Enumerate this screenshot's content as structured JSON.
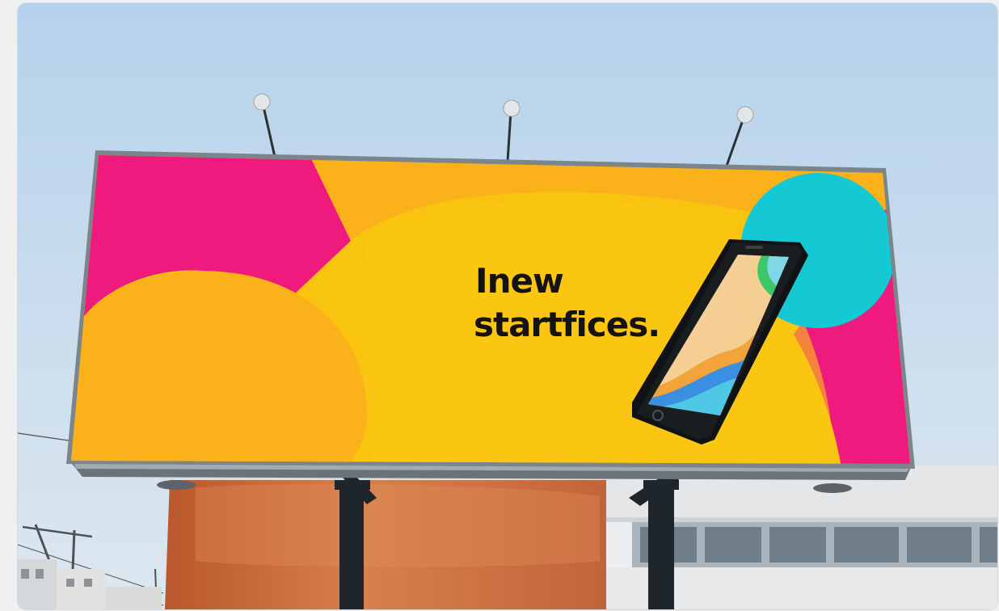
{
  "billboard": {
    "headline_line1": "Inew",
    "headline_line2": "startfices."
  },
  "colors": {
    "sky_top": "#b8d3ec",
    "sky_bottom": "#dbe6ef",
    "magenta": "#ee1a7e",
    "yellow": "#f9c40f",
    "orange": "#fbb21a",
    "cyan": "#14c9d4",
    "building_orange": "#c96a3a",
    "building_white": "#e9ebec",
    "pole": "#1d2428"
  },
  "icons": {
    "phone": "smartphone-icon",
    "lamps": "spotlight-icon"
  }
}
